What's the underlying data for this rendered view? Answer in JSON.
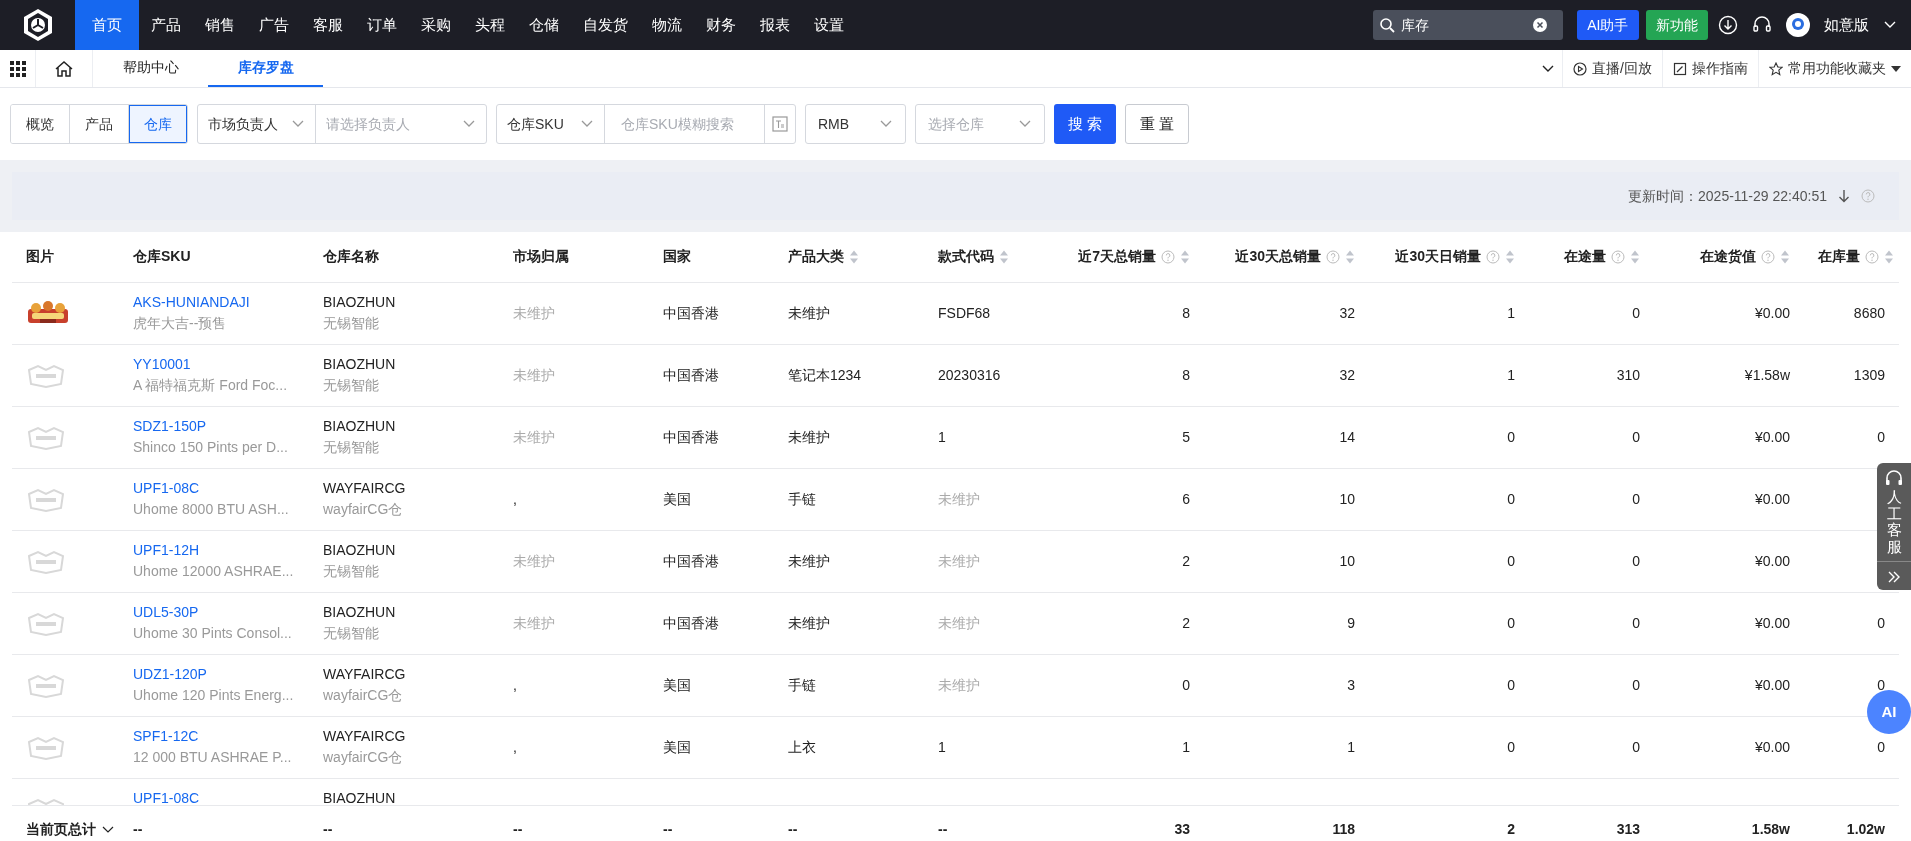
{
  "top_nav": {
    "menu": [
      {
        "label": "首页",
        "selected": true
      },
      {
        "label": "产品",
        "selected": false
      },
      {
        "label": "销售",
        "selected": false
      },
      {
        "label": "广告",
        "selected": false
      },
      {
        "label": "客服",
        "selected": false
      },
      {
        "label": "订单",
        "selected": false
      },
      {
        "label": "采购",
        "selected": false
      },
      {
        "label": "头程",
        "selected": false
      },
      {
        "label": "仓储",
        "selected": false
      },
      {
        "label": "自发货",
        "selected": false
      },
      {
        "label": "物流",
        "selected": false
      },
      {
        "label": "财务",
        "selected": false
      },
      {
        "label": "报表",
        "selected": false
      },
      {
        "label": "设置",
        "selected": false
      }
    ],
    "search": {
      "value": "库存"
    },
    "buttons": [
      {
        "label": "AI助手",
        "kind": "ai"
      },
      {
        "label": "新功能",
        "kind": "new"
      }
    ],
    "edition": "如意版"
  },
  "tab_bar": {
    "tabs": [
      {
        "label": "帮助中心",
        "selected": false
      },
      {
        "label": "库存罗盘",
        "selected": true
      }
    ],
    "links": [
      {
        "label": "直播/回放",
        "kind": "play"
      },
      {
        "label": "操作指南",
        "kind": "guide"
      },
      {
        "label": "常用功能收藏夹",
        "kind": "favorites"
      }
    ]
  },
  "filters": {
    "views": [
      {
        "label": "概览",
        "selected": false
      },
      {
        "label": "产品",
        "selected": false
      },
      {
        "label": "仓库",
        "selected": true
      }
    ],
    "owner_type": "市场负责人",
    "owner": {
      "placeholder": "请选择负责人"
    },
    "sku_type": "仓库SKU",
    "sku": {
      "placeholder": "仓库SKU模糊搜索"
    },
    "currency": "RMB",
    "warehouse": {
      "placeholder": "选择仓库"
    },
    "search_button": "搜 索",
    "reset_button": "重 置"
  },
  "update_time": "更新时间：2025-11-29 22:40:51",
  "table": {
    "columns": [
      {
        "label": "图片",
        "sortable": false,
        "help": false
      },
      {
        "label": "仓库SKU",
        "sortable": false,
        "help": false
      },
      {
        "label": "仓库名称",
        "sortable": false,
        "help": false
      },
      {
        "label": "市场归属",
        "sortable": false,
        "help": false
      },
      {
        "label": "国家",
        "sortable": false,
        "help": false
      },
      {
        "label": "产品大类",
        "sortable": true,
        "help": false
      },
      {
        "label": "款式代码",
        "sortable": true,
        "help": false
      },
      {
        "label": "近7天总销量",
        "sortable": true,
        "help": true
      },
      {
        "label": "近30天总销量",
        "sortable": true,
        "help": true
      },
      {
        "label": "近30天日销量",
        "sortable": true,
        "help": true
      },
      {
        "label": "在途量",
        "sortable": true,
        "help": true
      },
      {
        "label": "在途货值",
        "sortable": true,
        "help": true
      },
      {
        "label": "在库量",
        "sortable": true,
        "help": true
      }
    ],
    "rows": [
      {
        "sku": "AKS-HUNIANDAJI",
        "product": "虎年大吉--预售",
        "warehouse_code": "BIAOZHUN",
        "warehouse_name": "无锡智能",
        "market": {
          "text": "未维护",
          "muted": true
        },
        "country": "中国香港",
        "category": "未维护",
        "style": {
          "text": "FSDF68",
          "muted": false
        },
        "sales_7d": "8",
        "sales_30d": "32",
        "daily_30d": "1",
        "in_transit": "0",
        "transit_value": "¥0.00",
        "stock": "8680"
      },
      {
        "kind": "placeholder",
        "sku": "YY10001",
        "product": "A 福特福克斯 Ford Foc...",
        "warehouse_code": "BIAOZHUN",
        "warehouse_name": "无锡智能",
        "market": {
          "text": "未维护",
          "muted": true
        },
        "country": "中国香港",
        "category": "笔记本1234",
        "style": {
          "text": "20230316",
          "muted": false
        },
        "sales_7d": "8",
        "sales_30d": "32",
        "daily_30d": "1",
        "in_transit": "310",
        "transit_value": "¥1.58w",
        "stock": "1309"
      },
      {
        "kind": "placeholder",
        "sku": "SDZ1-150P",
        "product": "Shinco 150 Pints per D...",
        "warehouse_code": "BIAOZHUN",
        "warehouse_name": "无锡智能",
        "market": {
          "text": "未维护",
          "muted": true
        },
        "country": "中国香港",
        "category": "未维护",
        "style": {
          "text": "1",
          "muted": false
        },
        "sales_7d": "5",
        "sales_30d": "14",
        "daily_30d": "0",
        "in_transit": "0",
        "transit_value": "¥0.00",
        "stock": "0"
      },
      {
        "kind": "placeholder",
        "sku": "UPF1-08C",
        "product": "Uhome 8000 BTU ASH...",
        "warehouse_code": "WAYFAIRCG",
        "warehouse_name": "wayfairCG仓",
        "market": {
          "text": ",",
          "muted": false
        },
        "country": "美国",
        "category": "手链",
        "style": {
          "text": "未维护",
          "muted": true
        },
        "sales_7d": "6",
        "sales_30d": "10",
        "daily_30d": "0",
        "in_transit": "0",
        "transit_value": "¥0.00"
      },
      {
        "kind": "placeholder",
        "sku": "UPF1-12H",
        "product": "Uhome 12000 ASHRAE...",
        "warehouse_code": "BIAOZHUN",
        "warehouse_name": "无锡智能",
        "market": {
          "text": "未维护",
          "muted": true
        },
        "country": "中国香港",
        "category": "未维护",
        "style": {
          "text": "未维护",
          "muted": true
        },
        "sales_7d": "2",
        "sales_30d": "10",
        "daily_30d": "0",
        "in_transit": "0",
        "transit_value": "¥0.00"
      },
      {
        "kind": "placeholder",
        "sku": "UDL5-30P",
        "product": "Uhome 30 Pints Consol...",
        "warehouse_code": "BIAOZHUN",
        "warehouse_name": "无锡智能",
        "market": {
          "text": "未维护",
          "muted": true
        },
        "country": "中国香港",
        "category": "未维护",
        "style": {
          "text": "未维护",
          "muted": true
        },
        "sales_7d": "2",
        "sales_30d": "9",
        "daily_30d": "0",
        "in_transit": "0",
        "transit_value": "¥0.00",
        "stock": "0"
      },
      {
        "kind": "placeholder",
        "sku": "UDZ1-120P",
        "product": "Uhome 120 Pints Energ...",
        "warehouse_code": "WAYFAIRCG",
        "warehouse_name": "wayfairCG仓",
        "market": {
          "text": ",",
          "muted": false
        },
        "country": "美国",
        "category": "手链",
        "style": {
          "text": "未维护",
          "muted": true
        },
        "sales_7d": "0",
        "sales_30d": "3",
        "daily_30d": "0",
        "in_transit": "0",
        "transit_value": "¥0.00",
        "stock": "0"
      },
      {
        "kind": "placeholder",
        "sku": "SPF1-12C",
        "product": "12 000 BTU ASHRAE  P...",
        "warehouse_code": "WAYFAIRCG",
        "warehouse_name": "wayfairCG仓",
        "market": {
          "text": ",",
          "muted": false
        },
        "country": "美国",
        "category": "上衣",
        "style": {
          "text": "1",
          "muted": false
        },
        "sales_7d": "1",
        "sales_30d": "1",
        "daily_30d": "0",
        "in_transit": "0",
        "transit_value": "¥0.00",
        "stock": "0"
      },
      {
        "kind": "placeholder",
        "sku": "UPF1-08C",
        "warehouse_code": "BIAOZHUN"
      }
    ],
    "totals": {
      "label": "当前页总计",
      "cells": [
        "--",
        "--",
        "--",
        "--",
        "--",
        "--",
        "33",
        "118",
        "2",
        "313",
        "1.58w",
        "1.02w"
      ]
    }
  },
  "side_widget": {
    "label": "人工客服"
  },
  "ai_bubble": "AI"
}
